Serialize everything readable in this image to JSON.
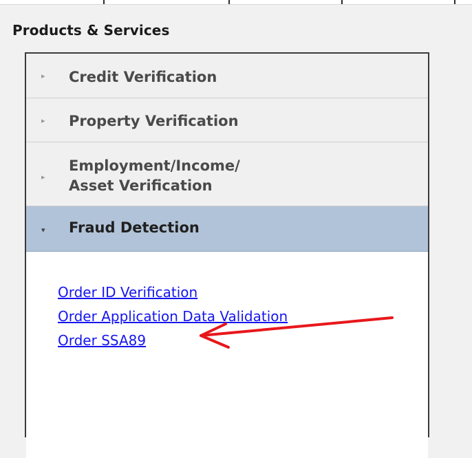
{
  "section_title": "Products & Services",
  "accordion": {
    "sections": [
      {
        "label": "Credit Verification",
        "arrow": "▸",
        "expanded": false
      },
      {
        "label": "Property Verification",
        "arrow": "▸",
        "expanded": false
      },
      {
        "label_line1": "Employment/Income/",
        "label_line2": "Asset Verification",
        "arrow": "▸",
        "expanded": false
      },
      {
        "label": "Fraud Detection",
        "arrow": "▾",
        "expanded": true
      }
    ],
    "fraud_links": [
      "Order ID Verification",
      "Order Application Data Validation",
      "Order SSA89"
    ]
  },
  "colors": {
    "active_header": "#b1c3d8",
    "link": "#1515ee",
    "annotation_arrow": "#e8171b"
  }
}
